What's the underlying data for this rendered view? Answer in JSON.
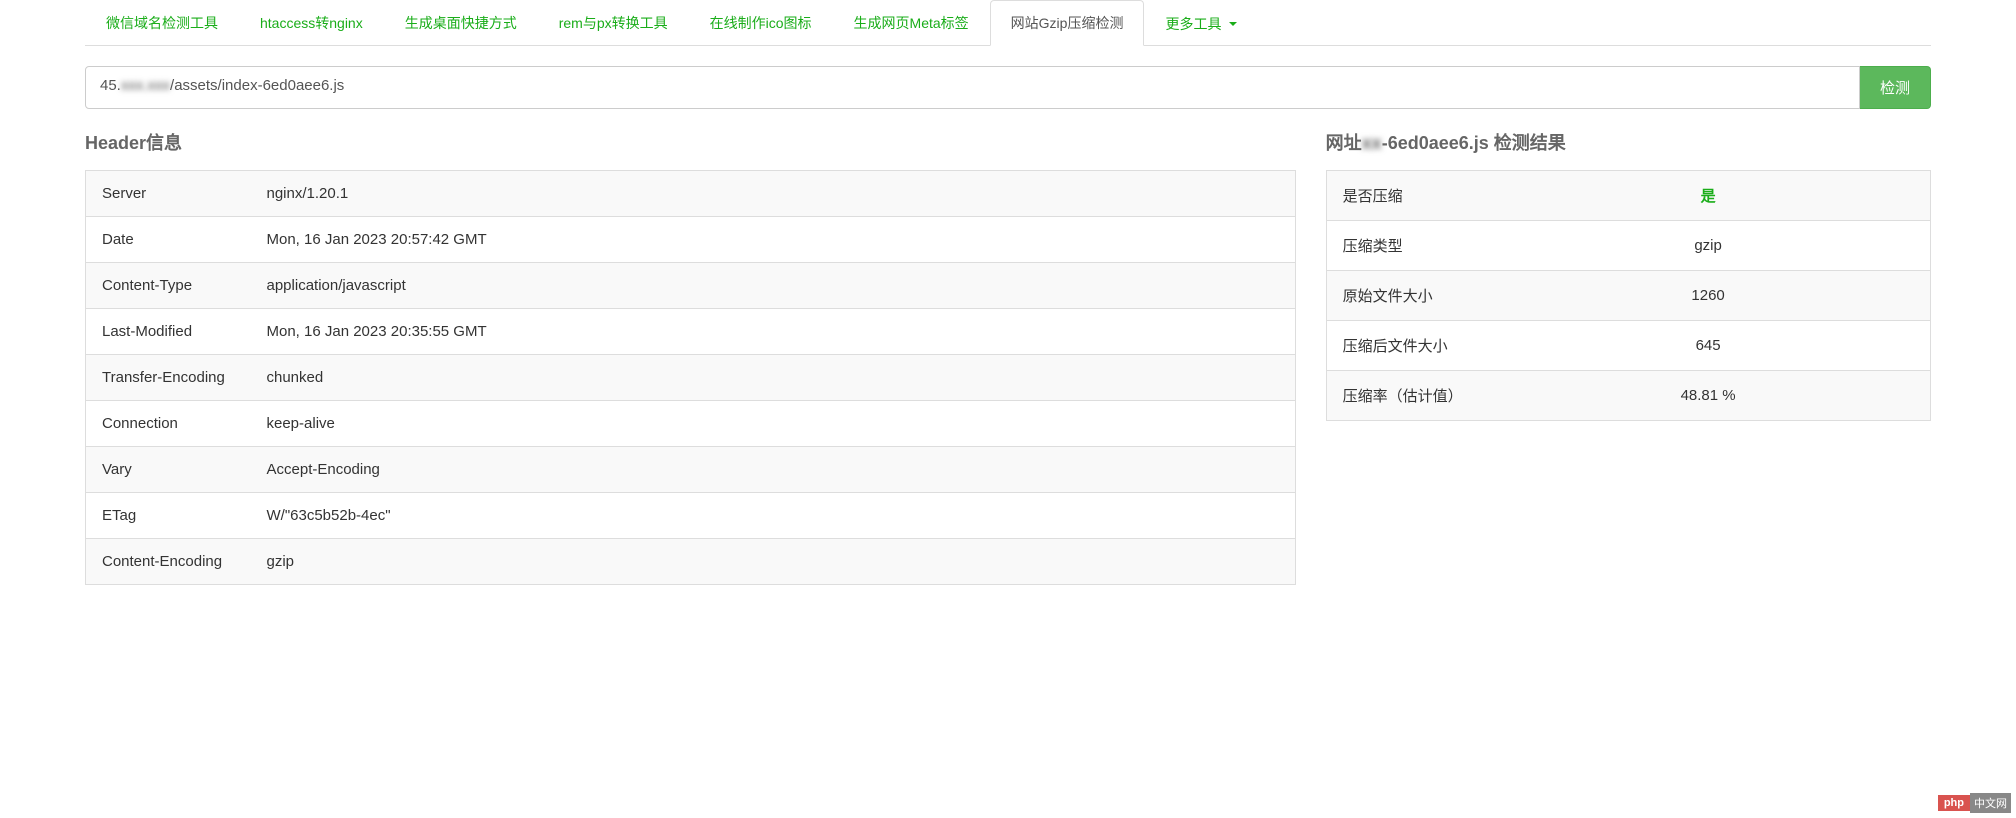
{
  "tabs": {
    "items": [
      "微信域名检测工具",
      "htaccess转nginx",
      "生成桌面快捷方式",
      "rem与px转换工具",
      "在线制作ico图标",
      "生成网页Meta标签",
      "网站Gzip压缩检测"
    ],
    "more_label": "更多工具"
  },
  "search": {
    "value_prefix": "45.",
    "value_blurred": "xxx.xxx",
    "value_suffix": "/assets/index-6ed0aee6.js",
    "button_label": "检测"
  },
  "header_section": {
    "title": "Header信息",
    "rows": [
      {
        "key": "Server",
        "value": "nginx/1.20.1"
      },
      {
        "key": "Date",
        "value": "Mon, 16 Jan 2023 20:57:42 GMT"
      },
      {
        "key": "Content-Type",
        "value": "application/javascript"
      },
      {
        "key": "Last-Modified",
        "value": "Mon, 16 Jan 2023 20:35:55 GMT"
      },
      {
        "key": "Transfer-Encoding",
        "value": "chunked"
      },
      {
        "key": "Connection",
        "value": "keep-alive"
      },
      {
        "key": "Vary",
        "value": "Accept-Encoding"
      },
      {
        "key": "ETag",
        "value": "W/\"63c5b52b-4ec\""
      },
      {
        "key": "Content-Encoding",
        "value": "gzip"
      }
    ]
  },
  "result_section": {
    "title_prefix": "网址",
    "title_blurred": "xx",
    "title_mid": "-6ed0aee6.js",
    "title_suffix": " 检测结果",
    "rows": [
      {
        "key": "是否压缩",
        "value": "是",
        "green": true
      },
      {
        "key": "压缩类型",
        "value": "gzip"
      },
      {
        "key": "原始文件大小",
        "value": "1260"
      },
      {
        "key": "压缩后文件大小",
        "value": "645"
      },
      {
        "key": "压缩率（估计值）",
        "value": "48.81 %"
      }
    ]
  },
  "watermark": {
    "php": "php",
    "cn": "中文网"
  }
}
